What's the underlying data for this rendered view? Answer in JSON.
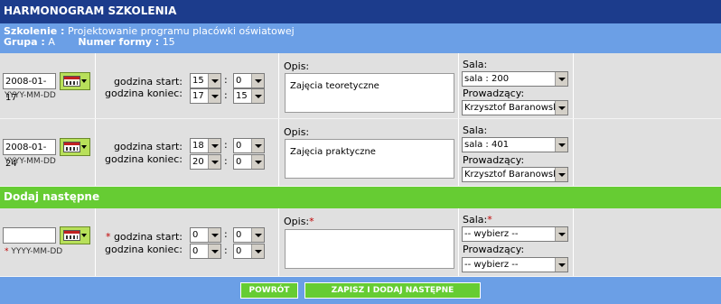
{
  "title": "HARMONOGRAM SZKOLENIA",
  "info": {
    "szkolenie_label": "Szkolenie :",
    "szkolenie_value": "Projektowanie programu placówki oświatowej",
    "grupa_label": "Grupa :",
    "grupa_value": "A",
    "numer_label": "Numer formy :",
    "numer_value": "15"
  },
  "sessions": [
    {
      "date": "2008-01-17",
      "date_format": "YYYY-MM-DD",
      "start_label": "godzina start:",
      "end_label": "godzina koniec:",
      "start_hour": "15",
      "start_min": "0",
      "end_hour": "17",
      "end_min": "15",
      "opis_label": "Opis:",
      "opis": "Zajęcia teoretyczne",
      "sala_label": "Sala:",
      "sala": "sala : 200",
      "prowadzacy_label": "Prowadzący:",
      "prowadzacy": "Krzysztof Baranowski"
    },
    {
      "date": "2008-01-24",
      "date_format": "YYYY-MM-DD",
      "start_label": "godzina start:",
      "end_label": "godzina koniec:",
      "start_hour": "18",
      "start_min": "0",
      "end_hour": "20",
      "end_min": "0",
      "opis_label": "Opis:",
      "opis": "Zajęcia praktyczne",
      "sala_label": "Sala:",
      "sala": "sala : 401",
      "prowadzacy_label": "Prowadzący:",
      "prowadzacy": "Krzysztof Baranowski"
    }
  ],
  "add_section_title": "Dodaj następne",
  "new_entry": {
    "date": "",
    "date_format": "YYYY-MM-DD",
    "start_label": "godzina start:",
    "end_label": "godzina koniec:",
    "start_hour": "0",
    "start_min": "0",
    "end_hour": "0",
    "end_min": "0",
    "opis_label": "Opis:",
    "sala_label": "Sala:",
    "sala": "-- wybierz --",
    "prowadzacy_label": "Prowadzący:",
    "prowadzacy": "-- wybierz --",
    "required_mark": "*"
  },
  "buttons": {
    "back": "POWRÓT",
    "save_add": "ZAPISZ I DODAJ NASTĘPNE"
  }
}
